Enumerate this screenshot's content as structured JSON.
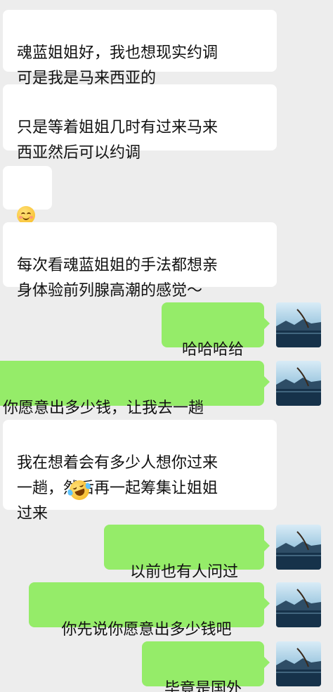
{
  "colors": {
    "background": "#ededed",
    "incoming_bubble": "#ffffff",
    "outgoing_bubble": "#95ec69",
    "text": "#111111"
  },
  "messages": [
    {
      "side": "incoming",
      "text": "魂蓝姐姐好，我也想现实约调\n可是我是马来西亚的"
    },
    {
      "side": "incoming",
      "text": "只是等着姐姐几时有过来马来\n西亚然后可以约调"
    },
    {
      "side": "incoming",
      "text": "",
      "emoji": "smiling-face-icon"
    },
    {
      "side": "incoming",
      "text": "每次看魂蓝姐姐的手法都想亲\n身体验前列腺高潮的感觉～"
    },
    {
      "side": "outgoing",
      "text": "哈哈哈给"
    },
    {
      "side": "outgoing",
      "text": "你愿意出多少钱，让我去一趟"
    },
    {
      "side": "incoming",
      "text": "我在想着会有多少人想你过来\n一趟，然后再一起筹集让姐姐\n过来",
      "emoji": "laughing-tears-icon"
    },
    {
      "side": "outgoing",
      "text": "以前也有人问过"
    },
    {
      "side": "outgoing",
      "text": "你先说你愿意出多少钱吧"
    },
    {
      "side": "outgoing",
      "text": "毕竟是国外"
    }
  ]
}
